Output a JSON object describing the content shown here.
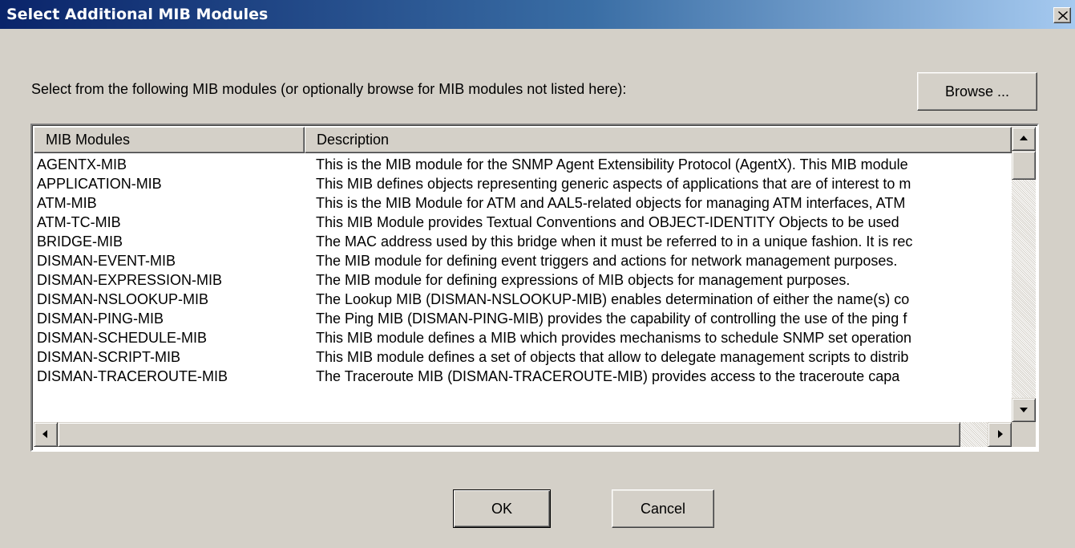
{
  "window": {
    "title": "Select Additional MIB Modules",
    "close_icon": "close-x-icon"
  },
  "instruction": "Select from the following MIB modules (or optionally browse for MIB modules not listed here):",
  "browse_button": "Browse ...",
  "list": {
    "columns": [
      "MIB Modules",
      "Description"
    ],
    "rows": [
      {
        "module": "AGENTX-MIB",
        "description": "This is the MIB module for the SNMP Agent Extensibility Protocol (AgentX). This MIB module"
      },
      {
        "module": "APPLICATION-MIB",
        "description": "This MIB defines objects representing generic aspects of applications that are of interest to m"
      },
      {
        "module": "ATM-MIB",
        "description": "This is the MIB Module for ATM and AAL5-related objects for managing ATM interfaces, ATM"
      },
      {
        "module": "ATM-TC-MIB",
        "description": "This MIB Module provides Textual Conventions and OBJECT-IDENTITY Objects to be used"
      },
      {
        "module": "BRIDGE-MIB",
        "description": "The MAC address used by this bridge when it must be referred to in a unique fashion. It is rec"
      },
      {
        "module": "DISMAN-EVENT-MIB",
        "description": "The MIB module for defining event triggers and actions for network management purposes."
      },
      {
        "module": "DISMAN-EXPRESSION-MIB",
        "description": "The MIB module for defining expressions of MIB objects for management purposes."
      },
      {
        "module": "DISMAN-NSLOOKUP-MIB",
        "description": "The Lookup MIB (DISMAN-NSLOOKUP-MIB) enables determination of either the name(s) co"
      },
      {
        "module": "DISMAN-PING-MIB",
        "description": "The Ping MIB (DISMAN-PING-MIB) provides the capability of controlling the use of the ping f"
      },
      {
        "module": "DISMAN-SCHEDULE-MIB",
        "description": "This MIB module defines a MIB which provides mechanisms to schedule SNMP set operation"
      },
      {
        "module": "DISMAN-SCRIPT-MIB",
        "description": "This MIB module defines a set of objects that allow to delegate management scripts to distrib"
      },
      {
        "module": "DISMAN-TRACEROUTE-MIB",
        "description": "The Traceroute MIB (DISMAN-TRACEROUTE-MIB) provides access to the traceroute capa"
      }
    ]
  },
  "scrollbars": {
    "up_icon": "arrow-up-icon",
    "down_icon": "arrow-down-icon",
    "left_icon": "arrow-left-icon",
    "right_icon": "arrow-right-icon"
  },
  "buttons": {
    "ok": "OK",
    "cancel": "Cancel"
  },
  "colors": {
    "titlebar_start": "#0a246a",
    "titlebar_end": "#a6caf0",
    "dialog_bg": "#d4d0c8",
    "list_bg": "#ffffff"
  }
}
